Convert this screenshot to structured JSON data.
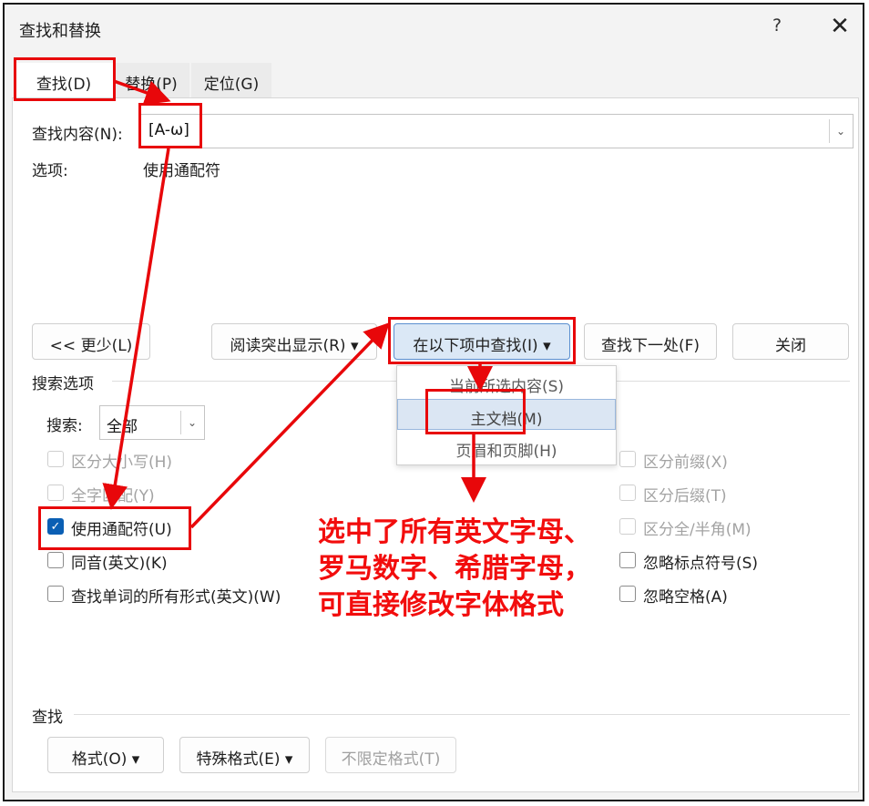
{
  "window": {
    "title": "查找和替换",
    "help_label": "?",
    "close_label": "✕"
  },
  "tabs": [
    {
      "label": "查找(D)",
      "active": true
    },
    {
      "label": "替换(P)",
      "active": false
    },
    {
      "label": "定位(G)",
      "active": false
    }
  ],
  "find": {
    "label": "查找内容(N):",
    "value": "[A-ω]",
    "options_label": "选项:",
    "options_value": "使用通配符"
  },
  "buttons": {
    "less": "<< 更少(L)",
    "reading_highlight": "阅读突出显示(R) ▾",
    "find_in": "在以下项中查找(I) ▾",
    "find_next": "查找下一处(F)",
    "close": "关闭"
  },
  "find_in_menu": [
    {
      "label": "当前所选内容(S)",
      "selected": false
    },
    {
      "label": "主文档(M)",
      "selected": true
    },
    {
      "label": "页眉和页脚(H)",
      "selected": false
    }
  ],
  "search_options": {
    "heading": "搜索选项",
    "search_label": "搜索:",
    "search_value": "全部",
    "left_checks": [
      {
        "label": "区分大小写(H)",
        "checked": false,
        "enabled": false
      },
      {
        "label": "全字匹配(Y)",
        "checked": false,
        "enabled": false
      },
      {
        "label": "使用通配符(U)",
        "checked": true,
        "enabled": true
      },
      {
        "label": "同音(英文)(K)",
        "checked": false,
        "enabled": true
      },
      {
        "label": "查找单词的所有形式(英文)(W)",
        "checked": false,
        "enabled": true
      }
    ],
    "right_checks": [
      {
        "label": "区分前缀(X)",
        "checked": false,
        "enabled": false
      },
      {
        "label": "区分后缀(T)",
        "checked": false,
        "enabled": false
      },
      {
        "label": "区分全/半角(M)",
        "checked": false,
        "enabled": false
      },
      {
        "label": "忽略标点符号(S)",
        "checked": false,
        "enabled": true
      },
      {
        "label": "忽略空格(A)",
        "checked": false,
        "enabled": true
      }
    ]
  },
  "find_section": {
    "heading": "查找",
    "format_button": "格式(O) ▾",
    "special_button": "特殊格式(E) ▾",
    "no_format_button": "不限定格式(T)"
  },
  "annotation": {
    "text": "选中了所有英文字母、\n罗马数字、希腊字母，\n可直接修改字体格式",
    "color": "#f20d0d"
  },
  "colors": {
    "accent": "#0a5fb4",
    "annotation_red": "#e8070a"
  }
}
